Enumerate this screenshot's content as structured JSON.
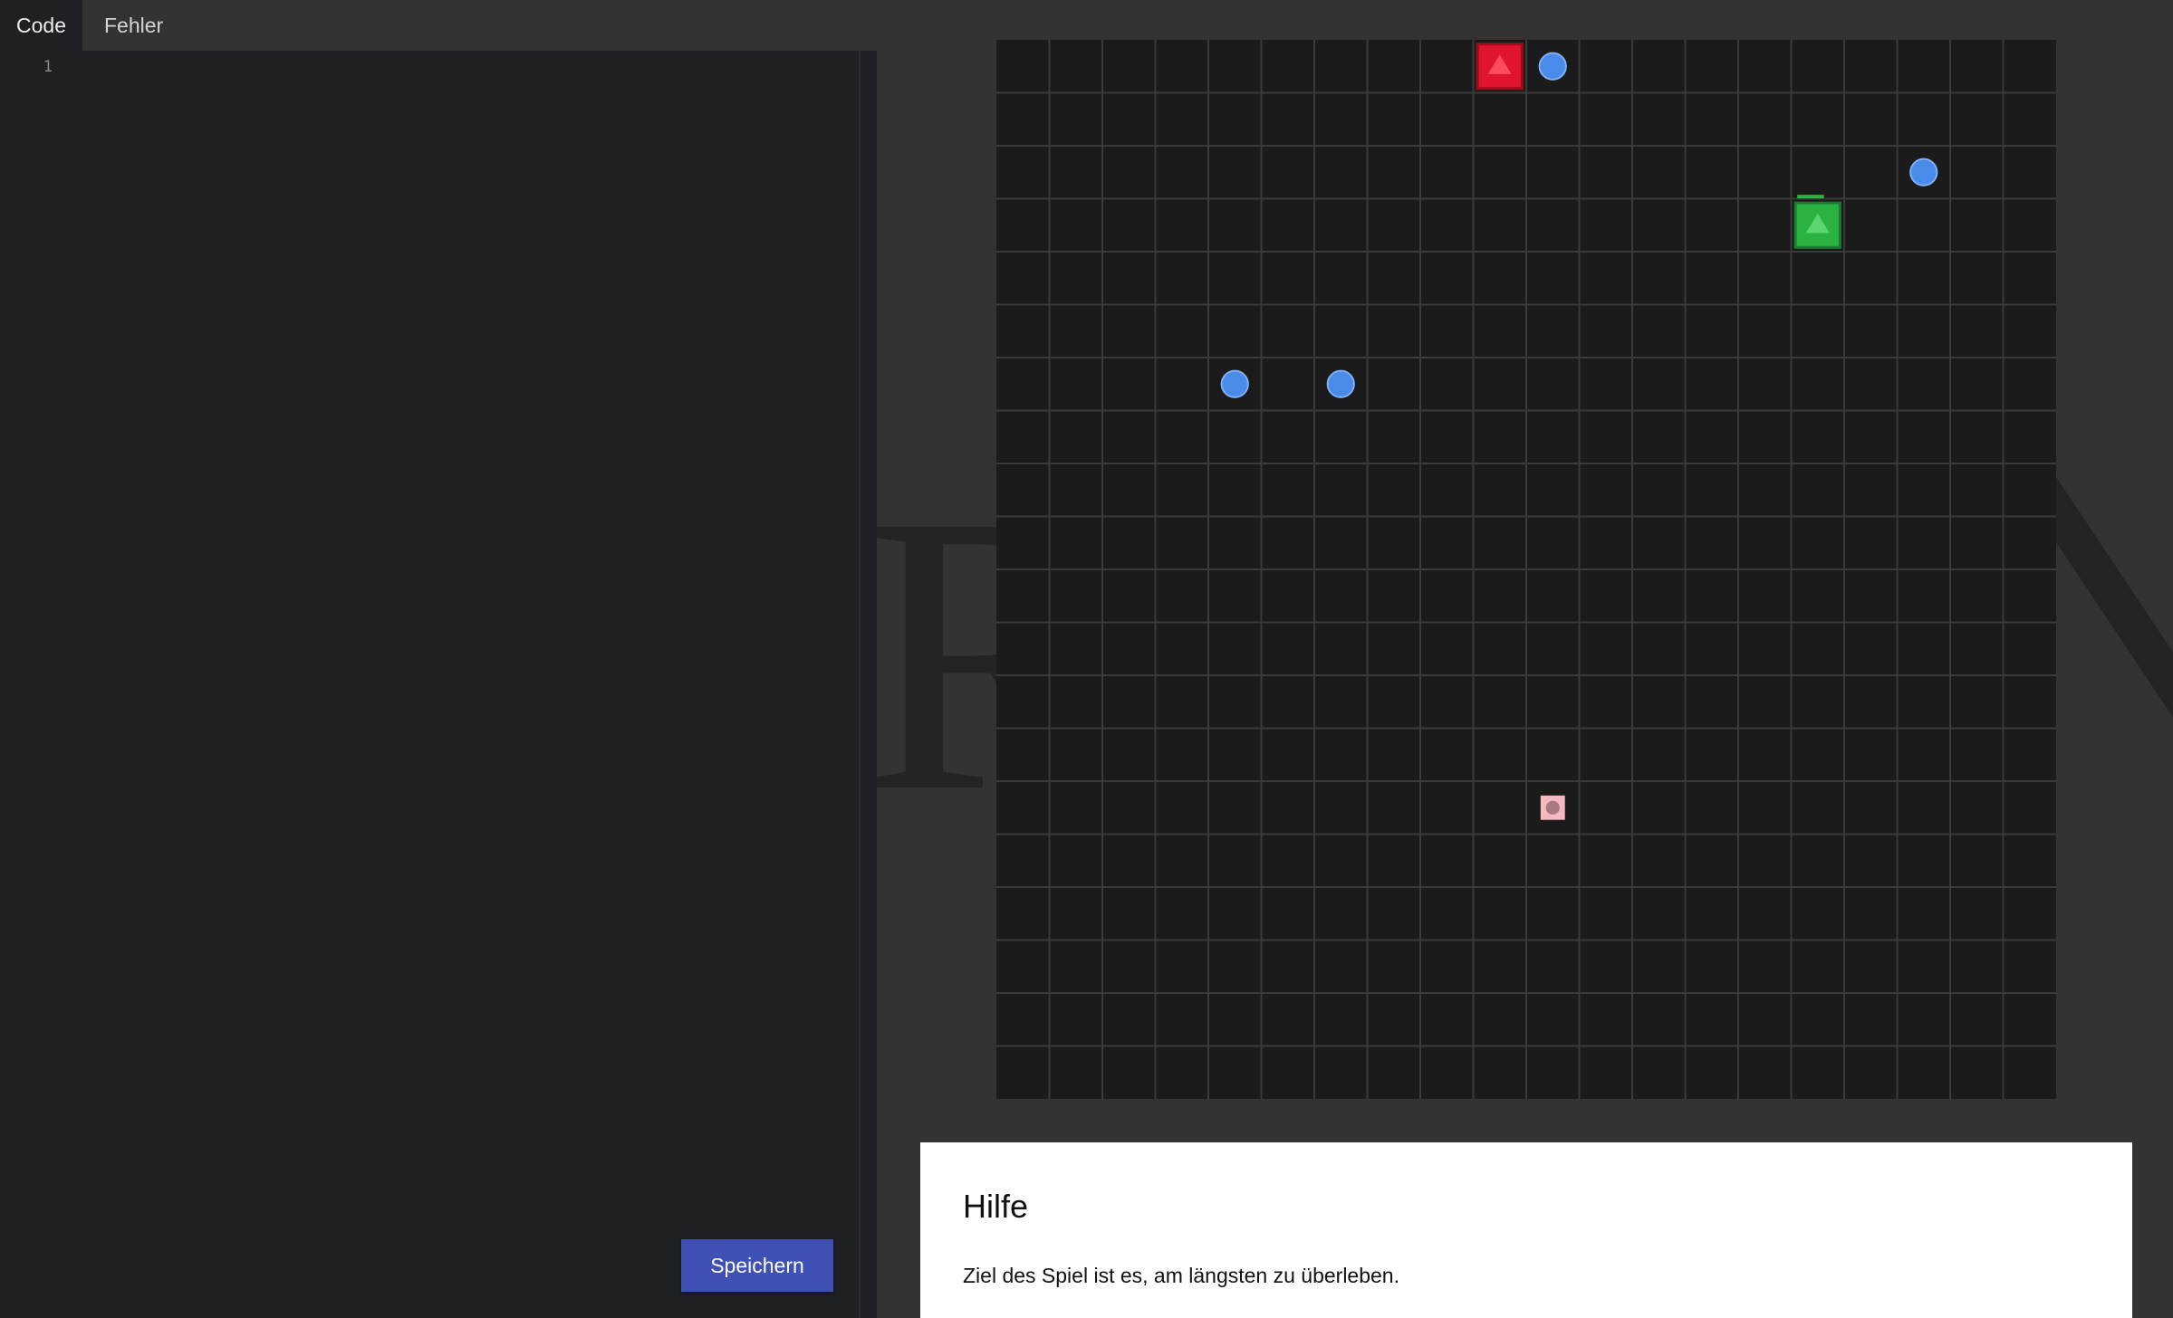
{
  "editor": {
    "tabs": [
      {
        "label": "Code",
        "active": true
      },
      {
        "label": "Fehler",
        "active": false
      }
    ],
    "line_numbers": [
      "1"
    ],
    "code": "",
    "save_label": "Speichern"
  },
  "game": {
    "watermark_text": "RN",
    "grid": {
      "columns": 20,
      "rows": 20
    },
    "colors": {
      "board": "#1b1b1b",
      "grid_line": "#3a3a3a",
      "orb": "#4a8ae8",
      "enemy_player": "#e0142f",
      "own_player": "#2bb342",
      "item": "#f3b8c0"
    },
    "entities": [
      {
        "type": "enemy-player",
        "icon": "red-square-triangle-icon",
        "col": 9,
        "row": 0
      },
      {
        "type": "own-player",
        "icon": "green-square-triangle-icon",
        "col": 15,
        "row": 3
      },
      {
        "type": "orb",
        "icon": "blue-circle-icon",
        "col": 10,
        "row": 0
      },
      {
        "type": "orb",
        "icon": "blue-circle-icon",
        "col": 17,
        "row": 2
      },
      {
        "type": "orb",
        "icon": "blue-circle-icon",
        "col": 4,
        "row": 6
      },
      {
        "type": "orb",
        "icon": "blue-circle-icon",
        "col": 6,
        "row": 6
      },
      {
        "type": "item",
        "icon": "pink-square-icon",
        "col": 10,
        "row": 14
      }
    ]
  },
  "help": {
    "title": "Hilfe",
    "text": "Ziel des Spiel ist es, am längsten zu überleben."
  }
}
